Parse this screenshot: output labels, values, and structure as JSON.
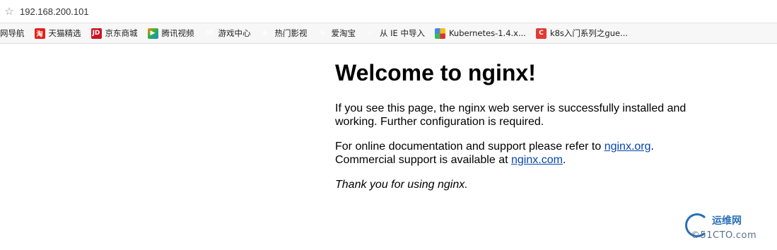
{
  "address_bar": {
    "url": "192.168.200.101",
    "star_icon": "star-outline-icon"
  },
  "bookmarks": [
    {
      "label": "网导航",
      "icon": "nav-icon"
    },
    {
      "label": "天猫精选",
      "icon": "tmall-icon"
    },
    {
      "label": "京东商城",
      "icon": "jd-icon"
    },
    {
      "label": "腾讯视频",
      "icon": "tencent-video-icon"
    },
    {
      "label": "游戏中心",
      "icon": "gamepad-icon"
    },
    {
      "label": "热门影视",
      "icon": "play-icon"
    },
    {
      "label": "爱淘宝",
      "icon": "globe-icon"
    },
    {
      "label": "从 IE 中导入",
      "icon": "folder-icon"
    },
    {
      "label": "Kubernetes-1.4.x...",
      "icon": "kubernetes-icon"
    },
    {
      "label": "k8s入门系列之gue...",
      "icon": "csdn-icon"
    }
  ],
  "page": {
    "heading": "Welcome to nginx!",
    "para1": "If you see this page, the nginx web server is successfully installed and working. Further configuration is required.",
    "para2_prefix": "For online documentation and support please refer to ",
    "link1": "nginx.org",
    "para2_mid": ".",
    "para2_line2": "Commercial support is available at ",
    "link2": "nginx.com",
    "para2_end": ".",
    "thanks": "Thank you for using nginx."
  },
  "watermark": {
    "line1": "运维网",
    "line2": "©51CTO.com"
  },
  "colors": {
    "link": "#0645ad",
    "bookmark_bar_bg": "#f7f7f7"
  }
}
